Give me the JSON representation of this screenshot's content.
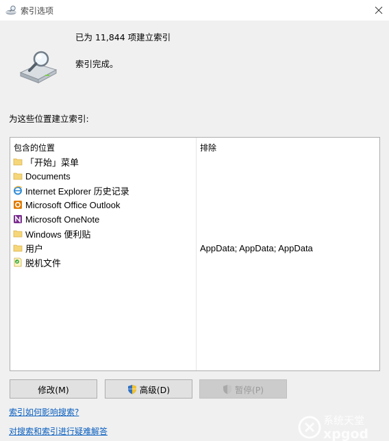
{
  "window": {
    "title": "索引选项",
    "close_label": "关闭"
  },
  "summary": {
    "count_text": "已为 11,844 项建立索引",
    "status_text": "索引完成。"
  },
  "locations_label": "为这些位置建立索引:",
  "table": {
    "headers": {
      "included": "包含的位置",
      "excluded": "排除"
    },
    "rows": [
      {
        "name": "「开始」菜单",
        "icon": "folder-icon",
        "exclude": ""
      },
      {
        "name": "Documents",
        "icon": "folder-icon",
        "exclude": ""
      },
      {
        "name": "Internet Explorer 历史记录",
        "icon": "internet-explorer-icon",
        "exclude": ""
      },
      {
        "name": "Microsoft Office Outlook",
        "icon": "outlook-icon",
        "exclude": ""
      },
      {
        "name": "Microsoft OneNote",
        "icon": "onenote-icon",
        "exclude": ""
      },
      {
        "name": "Windows 便利贴",
        "icon": "folder-icon",
        "exclude": ""
      },
      {
        "name": "用户",
        "icon": "folder-icon",
        "exclude": "AppData; AppData; AppData"
      },
      {
        "name": "脱机文件",
        "icon": "offline-files-icon",
        "exclude": ""
      }
    ]
  },
  "buttons": {
    "modify": "修改(M)",
    "advanced": "高级(D)",
    "pause": "暂停(P)"
  },
  "links": {
    "how_indexing_affects_search": "索引如何影响搜索?",
    "troubleshoot": "对搜索和索引进行疑难解答"
  },
  "watermark": {
    "text": "系统天堂",
    "sub": "xpgod"
  },
  "colors": {
    "link": "#0a5fbf",
    "folder": "#f5d67a"
  }
}
